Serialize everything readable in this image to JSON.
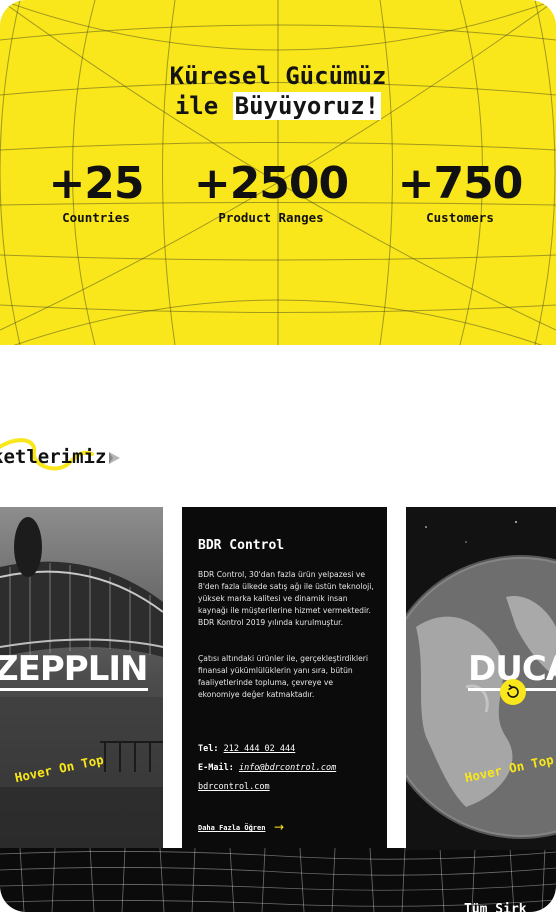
{
  "hero": {
    "title_line1": "Küresel Gücümüz",
    "title_line2_plain": "ile ",
    "title_line2_highlight": "Büyüyoruz!",
    "accent_color": "#f9e71b",
    "stats": [
      {
        "value": "+25",
        "label": "Countries"
      },
      {
        "value": "+2500",
        "label": "Product Ranges"
      },
      {
        "value": "+750",
        "label": "Customers"
      }
    ]
  },
  "brands_section": {
    "label": "ketlerimiz",
    "arrow_icon": "play-arrow-icon",
    "cards": [
      {
        "name": "ZEPPLIN",
        "hover_tag": "Hover On Top"
      },
      {
        "name": "DUCA",
        "hover_tag": "Hover On Top",
        "icon": "refresh-icon"
      }
    ],
    "info_panel": {
      "title": "BDR Control",
      "paragraph1": "BDR Control, 30'dan fazla ürün yelpazesi ve 8'den fazla ülkede satış ağı ile üstün teknoloji, yüksek marka kalitesi ve dinamik insan kaynağı ile müşterilerine hizmet vermektedir. BDR Kontrol 2019 yılında kurulmuştur.",
      "paragraph2": "Çatısı altındaki ürünler ile, gerçekleştirdikleri finansal yükümlülüklerin yanı sıra, bütün faaliyetlerinde topluma, çevreye ve ekonomiye değer katmaktadır.",
      "tel_label": "Tel:",
      "tel_value": "212 444 02 444",
      "email_label": "E-Mail:",
      "email_value": "info@bdrcontrol.com",
      "website": "bdrcontrol.com",
      "learn_more": "Daha Fazla Öğren",
      "learn_arrow": "→"
    },
    "all_link": "Tüm Sirk"
  }
}
